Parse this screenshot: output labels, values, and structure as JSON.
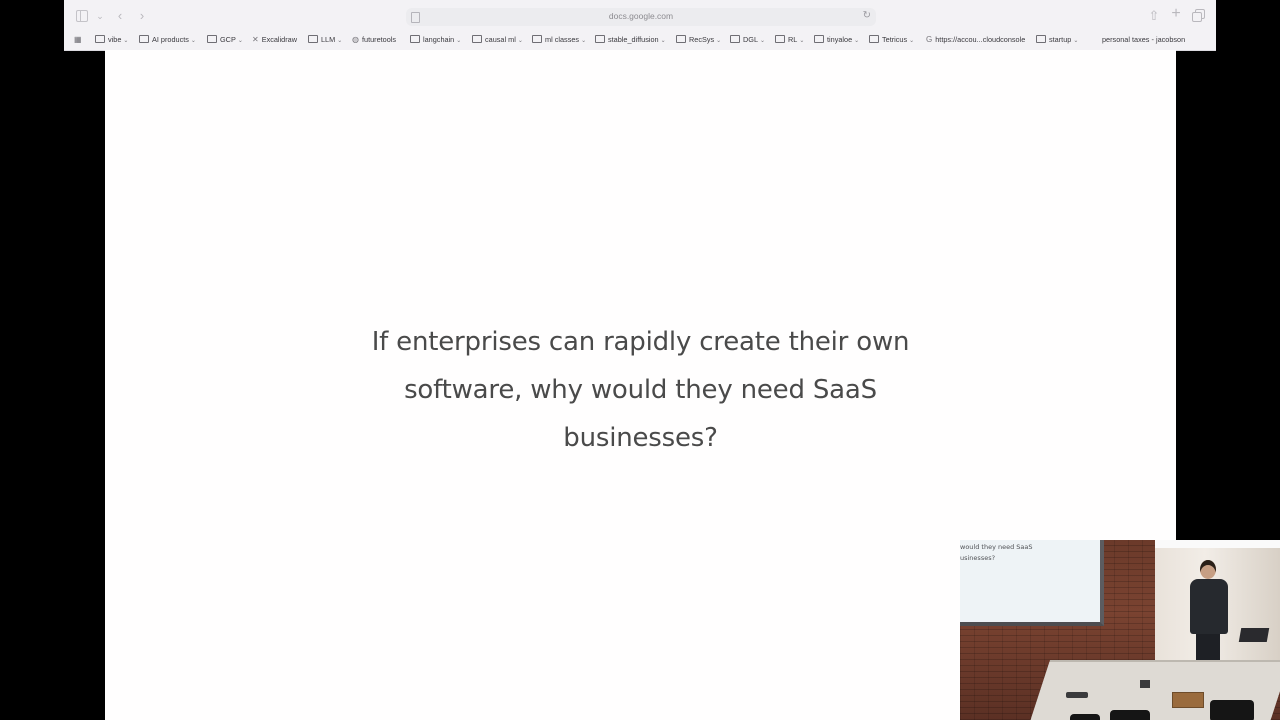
{
  "browser": {
    "url": "docs.google.com",
    "bookmarks": [
      {
        "label": "vibe",
        "kind": "folder"
      },
      {
        "label": "AI products",
        "kind": "folder"
      },
      {
        "label": "GCP",
        "kind": "folder"
      },
      {
        "label": "Excalidraw",
        "kind": "link"
      },
      {
        "label": "LLM",
        "kind": "folder"
      },
      {
        "label": "futuretools",
        "kind": "link"
      },
      {
        "label": "langchain",
        "kind": "folder"
      },
      {
        "label": "causal ml",
        "kind": "folder"
      },
      {
        "label": "ml classes",
        "kind": "folder"
      },
      {
        "label": "stable_diffusion",
        "kind": "folder"
      },
      {
        "label": "RecSys",
        "kind": "folder"
      },
      {
        "label": "DGL",
        "kind": "folder"
      },
      {
        "label": "RL",
        "kind": "folder"
      },
      {
        "label": "tinyaloe",
        "kind": "folder"
      },
      {
        "label": "Tetricus",
        "kind": "folder"
      },
      {
        "label": "https://accou...cloudconsole",
        "kind": "link"
      },
      {
        "label": "startup",
        "kind": "folder"
      },
      {
        "label": "personal taxes - jacobson",
        "kind": "link"
      }
    ]
  },
  "slide": {
    "lines": [
      "If enterprises can rapidly create their own",
      "software, why would they need SaaS",
      "businesses?"
    ]
  },
  "video": {
    "screen_lines": [
      "would they need SaaS",
      "usinesses?"
    ]
  }
}
